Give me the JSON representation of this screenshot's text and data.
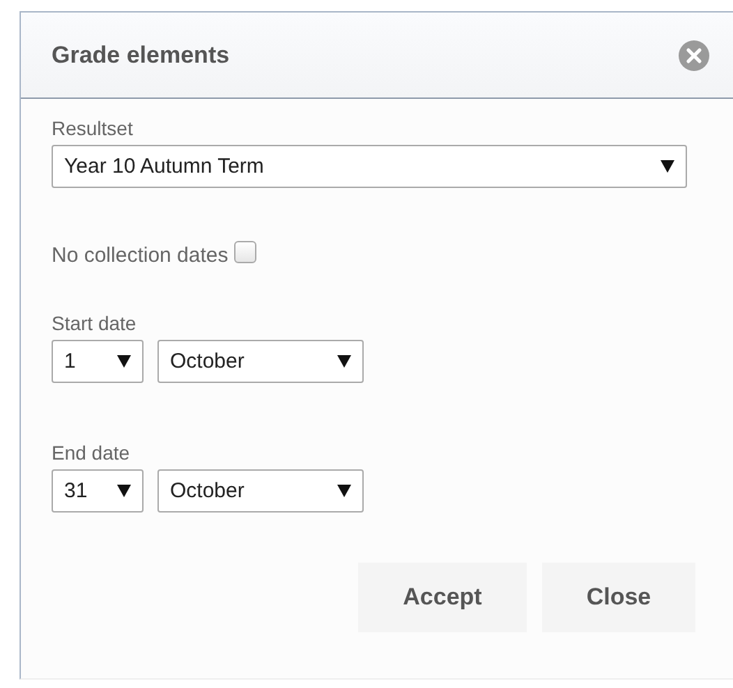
{
  "dialog": {
    "title": "Grade elements"
  },
  "resultset": {
    "label": "Resultset",
    "value": "Year 10 Autumn Term"
  },
  "no_collection_dates": {
    "label": "No collection dates",
    "checked": false
  },
  "start_date": {
    "label": "Start date",
    "day": "1",
    "month": "October"
  },
  "end_date": {
    "label": "End date",
    "day": "31",
    "month": "October"
  },
  "buttons": [
    "Accept",
    "Close"
  ]
}
